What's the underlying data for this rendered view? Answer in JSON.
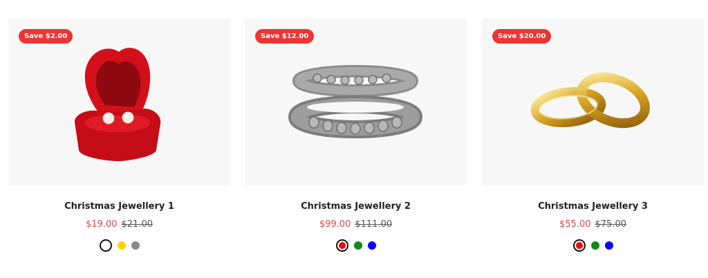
{
  "products": [
    {
      "title": "Christmas Jewellery 1",
      "badge": "Save $2.00",
      "price": "$19.00",
      "compare_price": "$21.00",
      "image_icon": "earring-box-icon",
      "swatches": [
        {
          "color": "#ffffff",
          "selected": true
        },
        {
          "color": "#ffd400",
          "selected": false
        },
        {
          "color": "#8a8a8a",
          "selected": false
        }
      ]
    },
    {
      "title": "Christmas Jewellery 2",
      "badge": "Save $12.00",
      "price": "$99.00",
      "compare_price": "$111.00",
      "image_icon": "silver-bangles-icon",
      "swatches": [
        {
          "color": "#ff0000",
          "selected": true
        },
        {
          "color": "#118a11",
          "selected": false
        },
        {
          "color": "#0000ff",
          "selected": false
        }
      ]
    },
    {
      "title": "Christmas Jewellery 3",
      "badge": "Save $20.00",
      "price": "$55.00",
      "compare_price": "$75.00",
      "image_icon": "gold-rings-icon",
      "swatches": [
        {
          "color": "#ff0000",
          "selected": true
        },
        {
          "color": "#118a11",
          "selected": false
        },
        {
          "color": "#0000ff",
          "selected": false
        }
      ]
    }
  ],
  "colors": {
    "badge_bg": "#ee3434",
    "sale_price": "#e64646",
    "media_bg": "#f7f7f7"
  }
}
